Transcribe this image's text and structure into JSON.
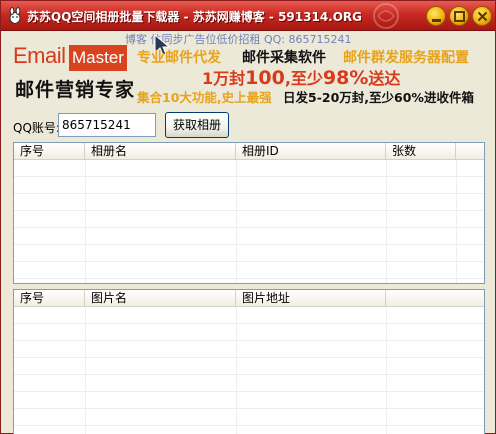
{
  "window": {
    "title": "苏苏QQ空间相册批量下载器 - 苏苏网赚博客 - 591314.ORG"
  },
  "banner": {
    "top_line": "博客    件同步广告位低价招租 QQ: 865715241",
    "logo_email": "Email",
    "logo_master": "Master",
    "logo_sub": "邮件营销专家",
    "ad_line1_a": "专业邮件代发",
    "ad_line1_b": "邮件采集软件",
    "ad_line1_c": "邮件群发服务器配置",
    "ad_line2_a": "1万封",
    "ad_line2_b": "100",
    "ad_line2_c": ",至少",
    "ad_line2_d": "98%",
    "ad_line2_e": "送达",
    "ad_line3_a": "集合10大功能,史上最强",
    "ad_line3_b": "日发5-20万封,至少60%进收件箱"
  },
  "form": {
    "qq_label": "QQ账号:",
    "qq_value": "865715241",
    "get_album_button": "获取相册"
  },
  "album_list": {
    "columns": [
      "序号",
      "相册名",
      "相册ID",
      "张数"
    ],
    "rows": []
  },
  "photo_list": {
    "columns": [
      "序号",
      "图片名",
      "图片地址"
    ],
    "rows": []
  },
  "colors": {
    "titlebar": "#c82a22",
    "ad_orange": "#e8a31a",
    "ad_red": "#d93a1c"
  }
}
